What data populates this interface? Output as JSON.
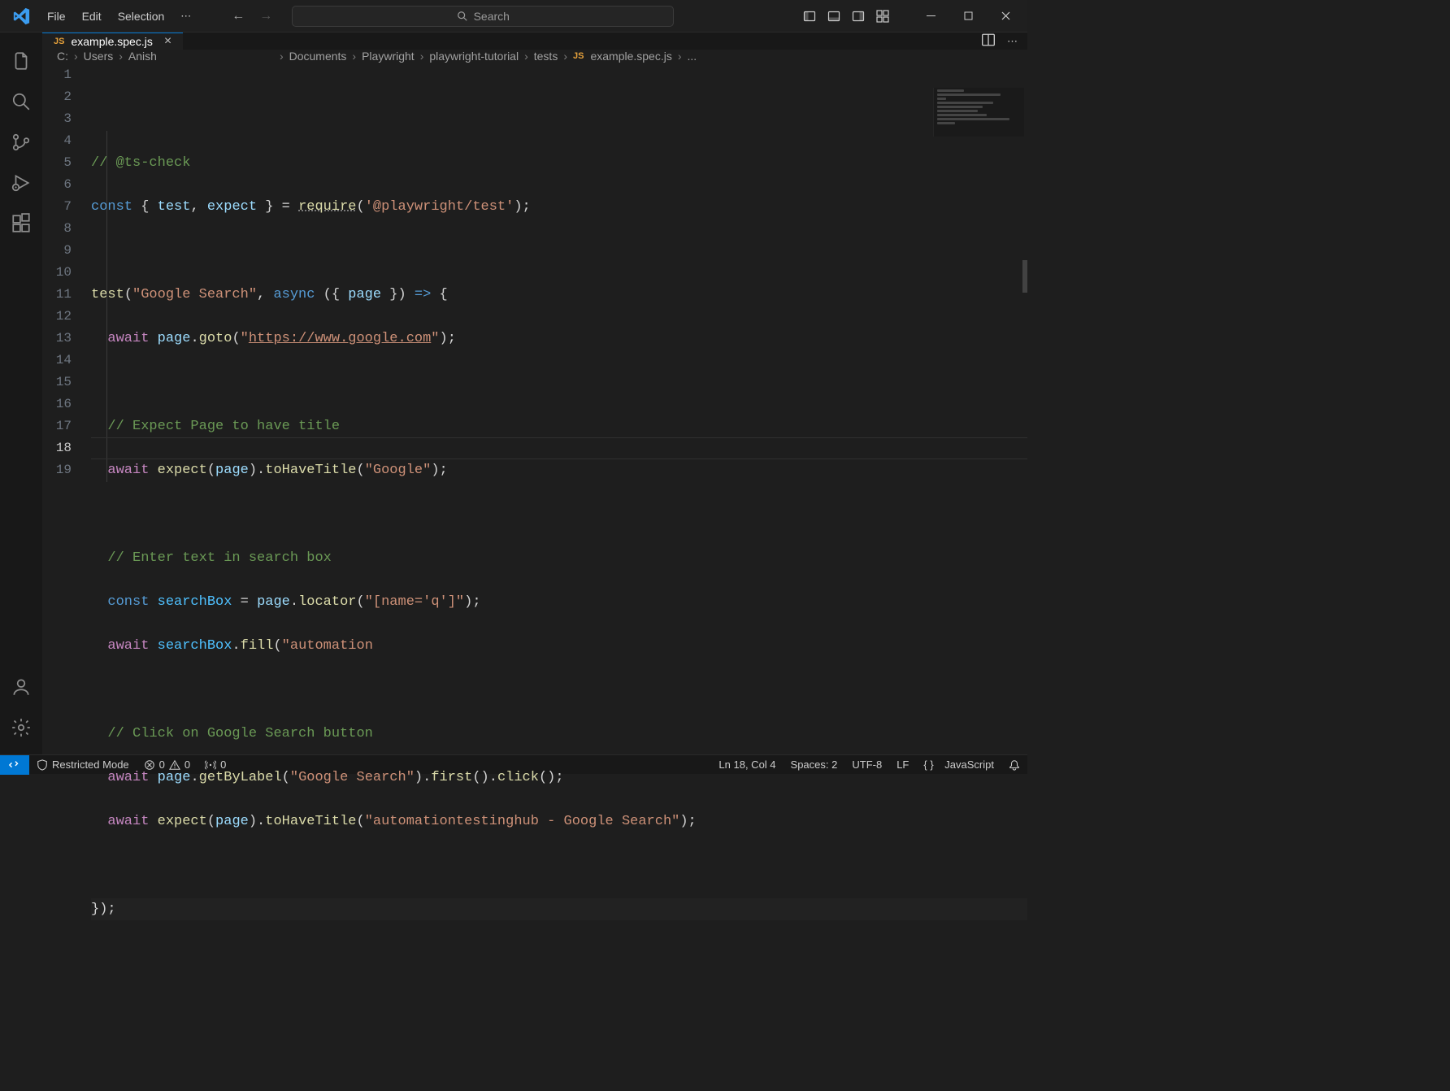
{
  "menubar": {
    "file": "File",
    "edit": "Edit",
    "selection": "Selection"
  },
  "search": {
    "placeholder": "Search"
  },
  "tab": {
    "filename": "example.spec.js"
  },
  "breadcrumb": {
    "driveRoot": "C:",
    "users": "Users",
    "anish": "Anish",
    "documents": "Documents",
    "playwright": "Playwright",
    "tutorial": "playwright-tutorial",
    "tests": "tests",
    "file": "example.spec.js",
    "more": "..."
  },
  "code": {
    "l1": "// @ts-check",
    "l2": {
      "const": "const",
      "br1": " { ",
      "test": "test",
      "comma": ", ",
      "expect": "expect",
      "br2": " } ",
      "eq": "= ",
      "req": "require",
      "p1": "(",
      "str": "'@playwright/test'",
      "p2": ");"
    },
    "l4": {
      "test": "test",
      "p1": "(",
      "str": "\"Google Search\"",
      "c": ", ",
      "async": "async",
      "p2": " ({ ",
      "page": "page",
      "p3": " }) ",
      "arrow": "=>",
      "p4": " {"
    },
    "l5": {
      "await": "await",
      "sp": " ",
      "page": "page",
      "dot": ".",
      "goto": "goto",
      "p1": "(",
      "q": "\"",
      "url": "https://www.google.com",
      "q2": "\"",
      "p2": ");"
    },
    "l7": "// Expect Page to have title",
    "l8": {
      "await": "await",
      "sp": " ",
      "expect": "expect",
      "p1": "(",
      "page": "page",
      "p2": ").",
      "to": "toHaveTitle",
      "p3": "(",
      "str": "\"Google\"",
      "p4": ");"
    },
    "l10": "// Enter text in search box",
    "l11": {
      "const": "const",
      "sp": " ",
      "sb": "searchBox",
      "eq": " = ",
      "page": "page",
      "dot": ".",
      "loc": "locator",
      "p1": "(",
      "str": "\"[name='q']\"",
      "p2": ");"
    },
    "l12": {
      "await": "await",
      "sp": " ",
      "sb": "searchBox",
      "dot": ".",
      "fill": "fill",
      "p1": "(",
      "str": "\"automation"
    },
    "l14": "// Click on Google Search button",
    "l15": {
      "await": "await",
      "sp": " ",
      "page": "page",
      "dot": ".",
      "gbl": "getByLabel",
      "p1": "(",
      "str": "\"Google Search\"",
      "p2": ").",
      "first": "first",
      "p3": "().",
      "click": "click",
      "p4": "();"
    },
    "l16": {
      "await": "await",
      "sp": " ",
      "expect": "expect",
      "p1": "(",
      "page": "page",
      "p2": ").",
      "to": "toHaveTitle",
      "p3": "(",
      "str": "\"automationtestinghub - Google Search\"",
      "p4": ");"
    },
    "l18": "});"
  },
  "status": {
    "restricted": "Restricted Mode",
    "errors": "0",
    "warnings": "0",
    "ports": "0",
    "lncol": "Ln 18, Col 4",
    "spaces": "Spaces: 2",
    "encoding": "UTF-8",
    "eol": "LF",
    "lang": "JavaScript"
  }
}
